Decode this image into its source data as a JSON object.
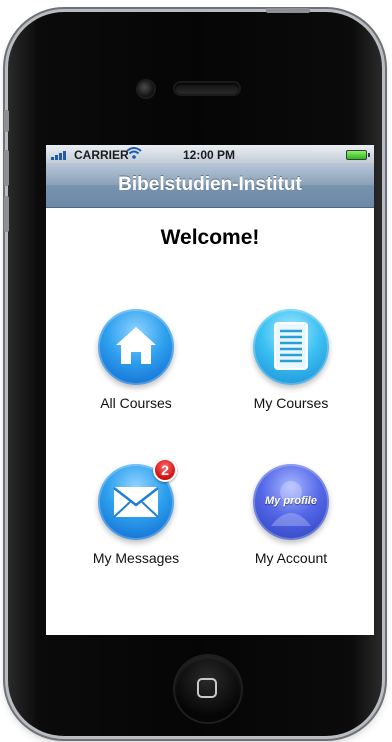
{
  "statusbar": {
    "carrier": "CARRIER",
    "time": "12:00 PM"
  },
  "navbar": {
    "title": "Bibelstudien-Institut"
  },
  "main": {
    "heading": "Welcome!",
    "tiles": [
      {
        "label": "All Courses",
        "icon": "home-icon"
      },
      {
        "label": "My Courses",
        "icon": "document-icon"
      },
      {
        "label": "My Messages",
        "icon": "envelope-icon",
        "badge": "2"
      },
      {
        "label": "My Account",
        "icon": "profile-icon",
        "icon_text": "My profile"
      }
    ]
  },
  "colors": {
    "navbar": "#7893ae",
    "icon_blue": "#2ea0ef",
    "badge_red": "#d10f0f"
  }
}
